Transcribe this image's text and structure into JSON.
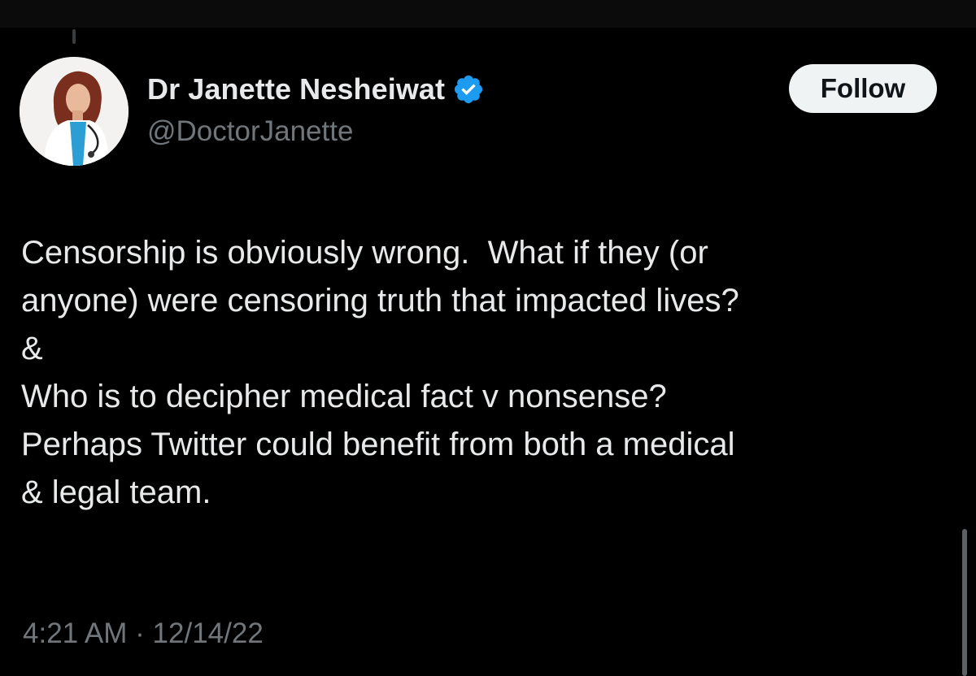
{
  "author": {
    "display_name": "Dr Janette Nesheiwat",
    "handle": "@DoctorJanette",
    "avatar_icon": "profile-photo",
    "verified_icon": "verified-badge-icon",
    "verified_color": "#1d9bf0"
  },
  "follow_button": {
    "label": "Follow"
  },
  "tweet": {
    "lines": [
      "Censorship is obviously wrong.  What if they (or",
      "anyone) were censoring truth that impacted lives?",
      "&",
      "Who is to decipher medical fact v nonsense?",
      "Perhaps Twitter could benefit from both a medical",
      "& legal team."
    ],
    "time": "4:21 AM",
    "separator": "·",
    "date": "12/14/22"
  },
  "colors": {
    "background": "#000000",
    "primary_text": "#e7e9ea",
    "secondary_text": "#71767b",
    "follow_button_bg": "#eff3f4",
    "follow_button_text": "#0f1419"
  }
}
